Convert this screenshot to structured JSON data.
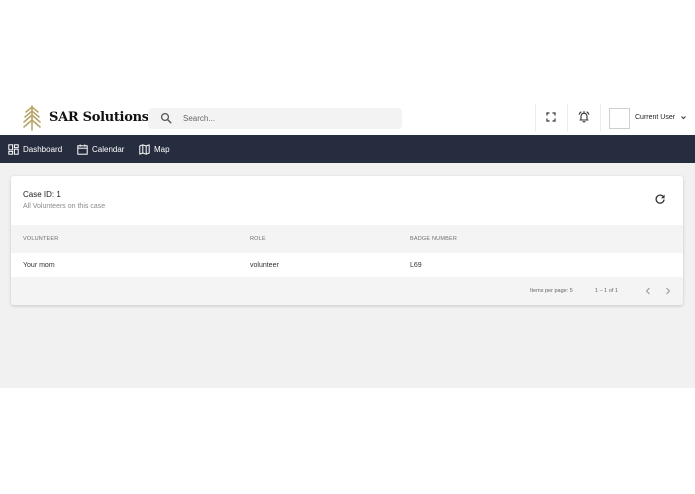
{
  "header": {
    "brand": "SAR Solutions",
    "search_placeholder": "Search...",
    "user_name": "Current User"
  },
  "nav": {
    "items": [
      {
        "label": "Dashboard",
        "icon": "dashboard-icon"
      },
      {
        "label": "Calendar",
        "icon": "calendar-icon"
      },
      {
        "label": "Map",
        "icon": "map-icon"
      }
    ]
  },
  "card": {
    "title": "Case ID: 1",
    "subtitle": "All Volunteers on this case",
    "columns": [
      "VOLUNTEER",
      "ROLE",
      "BADGE NUMBER"
    ],
    "rows": [
      {
        "volunteer": "Your mom",
        "role": "volunteer",
        "badge": "L69"
      }
    ],
    "pagination": {
      "items_per_page_label": "Items per page: 5",
      "range_label": "1 – 1 of 1"
    }
  },
  "colors": {
    "nav_bg": "#262d3e",
    "logo_gold": "#b9a46a",
    "page_bg": "#f1f1f1"
  }
}
